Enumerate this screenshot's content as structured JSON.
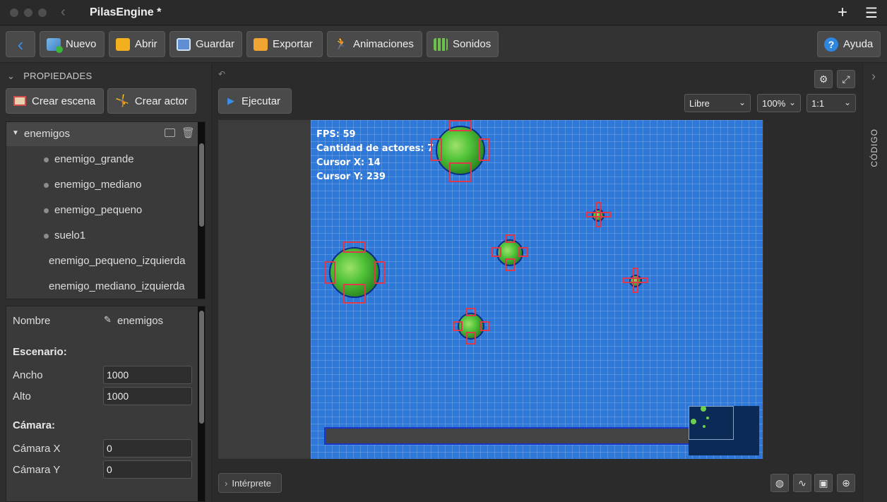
{
  "window": {
    "title": "PilasEngine *"
  },
  "toolbar": {
    "nuevo": "Nuevo",
    "abrir": "Abrir",
    "guardar": "Guardar",
    "exportar": "Exportar",
    "animaciones": "Animaciones",
    "sonidos": "Sonidos",
    "ayuda": "Ayuda"
  },
  "left_panel": {
    "section_title": "PROPIEDADES",
    "crear_escena": "Crear escena",
    "crear_actor": "Crear actor",
    "tree": {
      "scene": "enemigos",
      "items": [
        "enemigo_grande",
        "enemigo_mediano",
        "enemigo_pequeno",
        "suelo1"
      ],
      "extra_items": [
        "enemigo_pequeno_izquierda",
        "enemigo_mediano_izquierda"
      ]
    },
    "properties": {
      "nombre_label": "Nombre",
      "nombre_value": "enemigos",
      "escenario_heading": "Escenario:",
      "ancho_label": "Ancho",
      "ancho_value": "1000",
      "alto_label": "Alto",
      "alto_value": "1000",
      "camara_heading": "Cámara:",
      "camara_x_label": "Cámara X",
      "camara_x_value": "0",
      "camara_y_label": "Cámara Y",
      "camara_y_value": "0"
    }
  },
  "editor": {
    "run_label": "Ejecutar",
    "mode_select": "Libre",
    "zoom_select": "100%",
    "ratio_select": "1:1",
    "hud": {
      "fps": "FPS: 59",
      "actores": "Cantidad de actores: 7",
      "cursor_x": "Cursor X: 14",
      "cursor_y": "Cursor Y: 239"
    },
    "interprete_label": "Intérprete"
  },
  "right_panel": {
    "codigo_label": "CÓDIGO"
  },
  "colors": {
    "stage_blue": "#2e78d9",
    "hitbox_red": "#e0394b",
    "ball_green": "#52c53a"
  }
}
